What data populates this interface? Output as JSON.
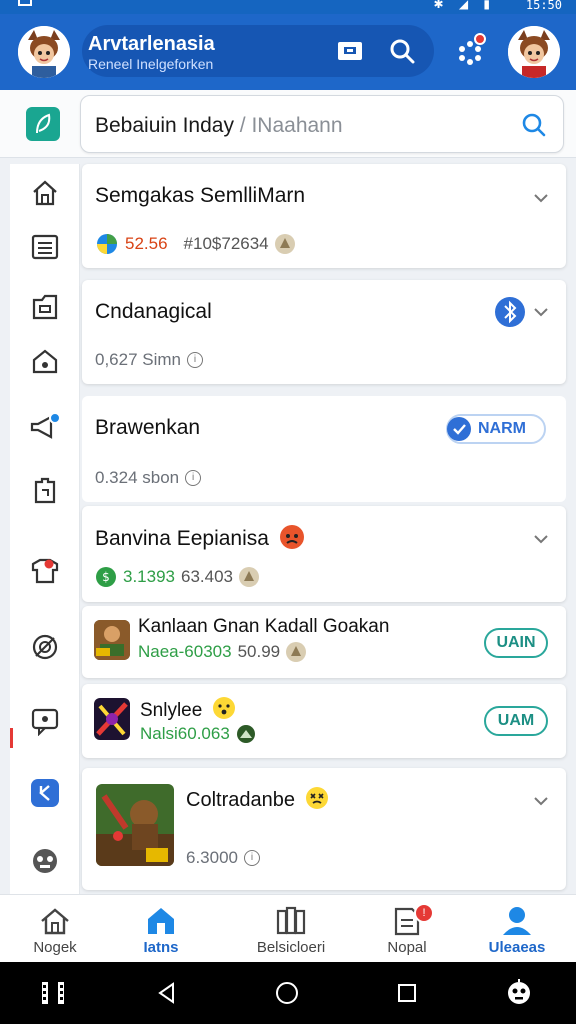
{
  "status_bar": {
    "time": "15:50",
    "icons": "✱ ◢ ▮"
  },
  "header": {
    "title": "Arvtarlenasia",
    "subtitle": "Reneel Inelgeforken"
  },
  "search": {
    "value": "Bebaiuin Inday",
    "placeholder": "/ INaahann"
  },
  "cards": [
    {
      "title": "Semgakas SemlliMarn",
      "stat_a": "52.56",
      "stat_b": "#10$72634"
    },
    {
      "title": "Cndanagical",
      "stat": "0,627 Simn"
    },
    {
      "title": "Brawenkan",
      "button": "NARM",
      "stat": "0.324 sbon"
    },
    {
      "title": "Banvina Eepianisa",
      "stat_a": "3.1393",
      "stat_b": "63.403"
    },
    {
      "title": "Kanlaan Gnan Kadall Goakan",
      "stat_a": "Naea-60303",
      "stat_b": "50.99",
      "button": "UAIN"
    },
    {
      "title": "Snlylee",
      "stat": "Nalsi60.063",
      "button": "UAM"
    },
    {
      "title": "Coltradanbe",
      "stat": "6.3000"
    }
  ],
  "bottom_nav": [
    {
      "label": "Nogek"
    },
    {
      "label": "Iatns"
    },
    {
      "label": "Belsicloeri"
    },
    {
      "label": "Nopal"
    },
    {
      "label": "Uleaeas"
    }
  ],
  "colors": {
    "primary": "#1e67c9",
    "accent_green": "#2aa79b",
    "badge_red": "#e53935"
  }
}
